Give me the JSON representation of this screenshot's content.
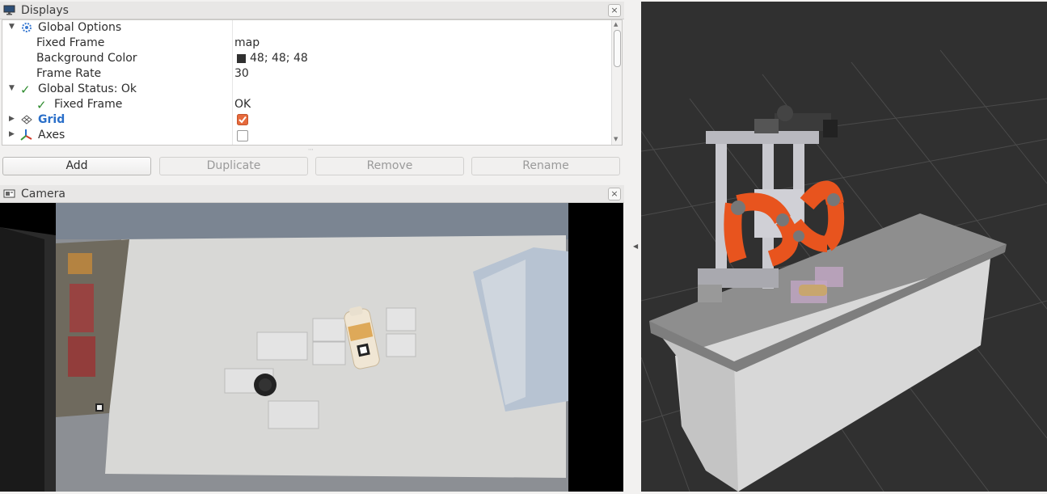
{
  "displays_panel": {
    "title": "Displays",
    "close": "×",
    "tree": [
      {
        "name": "Global Options",
        "value": "",
        "style": "bold"
      },
      {
        "name": "Fixed Frame",
        "value": "map"
      },
      {
        "name": "Background Color",
        "value": "48; 48; 48",
        "swatch": "#303030"
      },
      {
        "name": "Frame Rate",
        "value": "30"
      },
      {
        "name": "Global Status: Ok",
        "value": ""
      },
      {
        "name": "Fixed Frame",
        "value": "OK"
      },
      {
        "name": "Grid",
        "value": "",
        "checked": true,
        "color": "#2a6fc9"
      },
      {
        "name": "Axes",
        "value": "",
        "checked": false
      }
    ],
    "buttons": {
      "add": "Add",
      "duplicate": "Duplicate",
      "remove": "Remove",
      "rename": "Rename"
    }
  },
  "camera_panel": {
    "title": "Camera",
    "close": "×"
  },
  "colors": {
    "accent_blue": "#2a6fc9",
    "checkbox_orange": "#e66a3c",
    "status_green": "#2e8b2e",
    "viewport_bg": "#303030"
  }
}
